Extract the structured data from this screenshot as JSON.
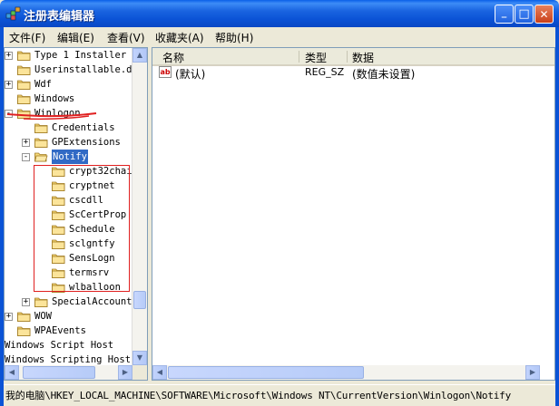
{
  "window": {
    "title": "注册表编辑器",
    "min_label": "_",
    "max_label": "□",
    "close_label": "✕"
  },
  "menu": [
    "文件(F)",
    "编辑(E)",
    "查看(V)",
    "收藏夹(A)",
    "帮助(H)"
  ],
  "tree": {
    "rows": [
      {
        "label": "Type 1 Installer",
        "level": 0,
        "expander": "+"
      },
      {
        "label": "Userinstallable.d",
        "level": 0,
        "expander": ""
      },
      {
        "label": "Wdf",
        "level": 0,
        "expander": "+"
      },
      {
        "label": "Windows",
        "level": 0,
        "expander": ""
      },
      {
        "label": "Winlogon",
        "level": 0,
        "expander": "-"
      },
      {
        "label": "Credentials",
        "level": 1,
        "expander": ""
      },
      {
        "label": "GPExtensions",
        "level": 1,
        "expander": "+"
      },
      {
        "label": "Notify",
        "level": 1,
        "expander": "-",
        "selected": true
      },
      {
        "label": "crypt32chai",
        "level": 2,
        "expander": ""
      },
      {
        "label": "cryptnet",
        "level": 2,
        "expander": ""
      },
      {
        "label": "cscdll",
        "level": 2,
        "expander": ""
      },
      {
        "label": "ScCertProp",
        "level": 2,
        "expander": ""
      },
      {
        "label": "Schedule",
        "level": 2,
        "expander": ""
      },
      {
        "label": "sclgntfy",
        "level": 2,
        "expander": ""
      },
      {
        "label": "SensLogn",
        "level": 2,
        "expander": ""
      },
      {
        "label": "termsrv",
        "level": 2,
        "expander": ""
      },
      {
        "label": "wlballoon",
        "level": 2,
        "expander": ""
      },
      {
        "label": "SpecialAccount",
        "level": 1,
        "expander": "+"
      },
      {
        "label": "WOW",
        "level": 0,
        "expander": "+"
      },
      {
        "label": "WPAEvents",
        "level": 0,
        "expander": ""
      },
      {
        "label": "Windows Script Host",
        "level": -1,
        "expander": ""
      },
      {
        "label": "Windows Scripting Host",
        "level": -1,
        "expander": ""
      }
    ]
  },
  "list": {
    "columns": [
      "名称",
      "类型",
      "数据"
    ],
    "rows": [
      {
        "name": "(默认)",
        "type": "REG_SZ",
        "data": "(数值未设置)",
        "icon": "string-value-icon"
      }
    ]
  },
  "statusbar": {
    "path": "我的电脑\\HKEY_LOCAL_MACHINE\\SOFTWARE\\Microsoft\\Windows NT\\CurrentVersion\\Winlogon\\Notify"
  },
  "colors": {
    "titlebar": "#0b53d6",
    "selection": "#316ac5",
    "annotation": "#e02020"
  }
}
